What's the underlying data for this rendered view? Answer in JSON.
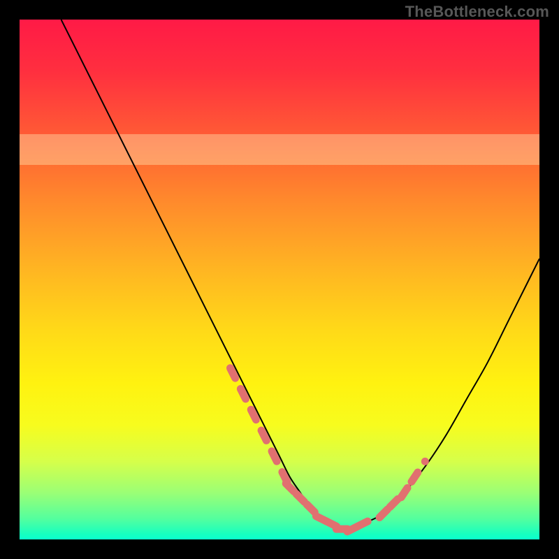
{
  "watermark": "TheBottleneck.com",
  "colors": {
    "frame_bg": "#000000",
    "curve_stroke": "#000000",
    "dot_fill": "#e17070",
    "dot_stroke": "#c55a5a"
  },
  "chart_data": {
    "type": "line",
    "title": "",
    "xlabel": "",
    "ylabel": "",
    "xlim": [
      0,
      100
    ],
    "ylim": [
      0,
      100
    ],
    "grid": false,
    "legend": false,
    "series": [
      {
        "name": "bottleneck-curve",
        "x": [
          8,
          12,
          16,
          20,
          24,
          28,
          32,
          36,
          40,
          44,
          46,
          48,
          50,
          52,
          54,
          56,
          58,
          60,
          62,
          64,
          66,
          70,
          74,
          78,
          82,
          86,
          90,
          94,
          98,
          100
        ],
        "y": [
          100,
          92,
          84,
          76,
          68,
          60,
          52,
          44,
          36,
          28,
          24,
          20,
          16,
          12,
          9,
          6,
          4,
          3,
          2,
          2,
          3,
          5,
          9,
          14,
          20,
          27,
          34,
          42,
          50,
          54
        ]
      }
    ],
    "highlight_points": {
      "name": "curve-dots",
      "x": [
        41,
        43,
        45,
        47,
        49,
        51,
        52,
        54,
        56,
        58,
        60,
        62,
        64,
        66,
        70,
        72,
        74,
        76,
        78
      ],
      "y": [
        32,
        28,
        24,
        20,
        16,
        12,
        10,
        8,
        6,
        4,
        3,
        2,
        2,
        3,
        5,
        7,
        9,
        12,
        15
      ]
    },
    "pale_band": {
      "y0": 72,
      "y1": 78
    }
  }
}
